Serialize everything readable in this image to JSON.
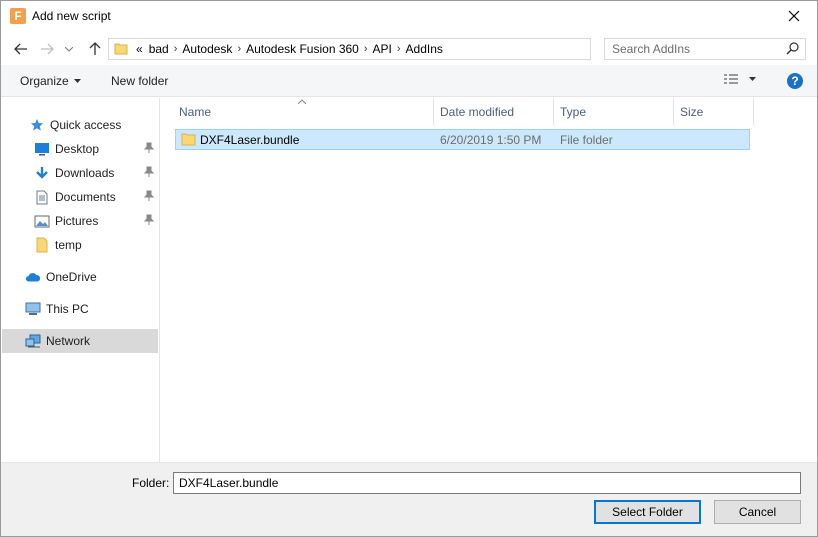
{
  "window": {
    "title": "Add new script",
    "app_icon_letter": "F",
    "app_icon_color": "#f3a04a"
  },
  "address": {
    "overflow": "«",
    "crumbs": [
      "bad",
      "Autodesk",
      "Autodesk Fusion 360",
      "API",
      "AddIns"
    ],
    "separator": "›"
  },
  "search": {
    "placeholder": "Search AddIns"
  },
  "toolbar": {
    "organize_label": "Organize",
    "new_folder_label": "New folder"
  },
  "sidebar": {
    "items": [
      {
        "label": "Quick access",
        "icon": "star-icon"
      },
      {
        "label": "Desktop",
        "icon": "desktop-icon",
        "pinned": true
      },
      {
        "label": "Downloads",
        "icon": "download-icon",
        "pinned": true
      },
      {
        "label": "Documents",
        "icon": "document-icon",
        "pinned": true
      },
      {
        "label": "Pictures",
        "icon": "picture-icon",
        "pinned": true
      },
      {
        "label": "temp",
        "icon": "folder-icon"
      },
      {
        "label": "OneDrive",
        "icon": "cloud-icon"
      },
      {
        "label": "This PC",
        "icon": "computer-icon"
      },
      {
        "label": "Network",
        "icon": "network-icon",
        "selected": true
      }
    ]
  },
  "columns": {
    "name": "Name",
    "date": "Date modified",
    "type": "Type",
    "size": "Size"
  },
  "files": [
    {
      "name": "DXF4Laser.bundle",
      "date": "6/20/2019 1:50 PM",
      "type": "File folder",
      "size": ""
    }
  ],
  "footer": {
    "folder_label": "Folder:",
    "folder_value": "DXF4Laser.bundle",
    "select_label": "Select Folder",
    "cancel_label": "Cancel"
  },
  "colors": {
    "selection": "#cce8ff",
    "selection_border": "#99d1ff",
    "accent": "#0078d7",
    "help": "#1a6fc7"
  }
}
